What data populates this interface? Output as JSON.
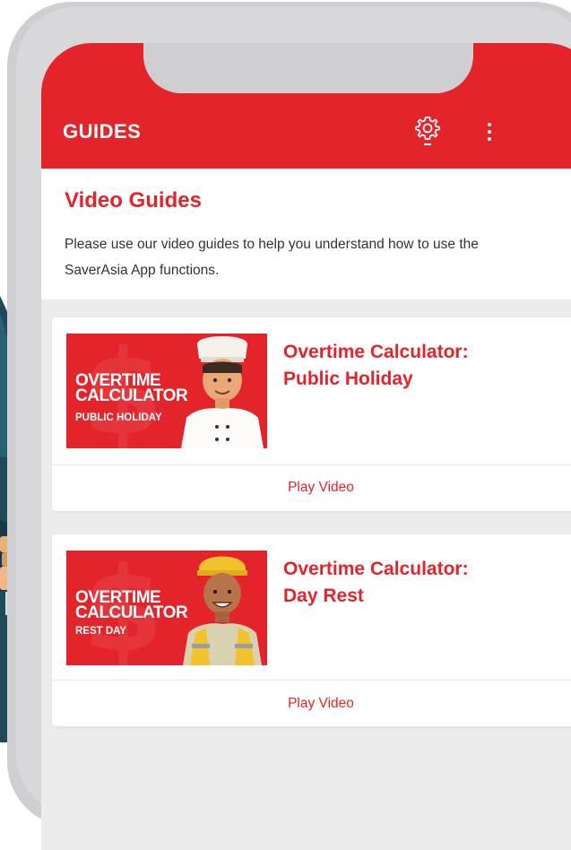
{
  "header": {
    "title": "GUIDES",
    "settings_icon": "gear-icon",
    "menu_icon": "more-vertical-icon",
    "color": "#e3242b"
  },
  "intro": {
    "title": "Video Guides",
    "text": "Please use our video guides to help you understand how to use the SaverAsia App functions."
  },
  "guides": [
    {
      "thumb_line1": "OVERTIME",
      "thumb_line2": "CALCULATOR",
      "thumb_sub": "PUBLIC HOLIDAY",
      "title_line1": "Overtime Calculator:",
      "title_line2": "Public Holiday",
      "play_label": "Play Video"
    },
    {
      "thumb_line1": "OVERTIME",
      "thumb_line2": "CALCULATOR",
      "thumb_sub": "REST DAY",
      "title_line1": "Overtime Calculator:",
      "title_line2": "Day Rest",
      "play_label": "Play Video"
    }
  ]
}
